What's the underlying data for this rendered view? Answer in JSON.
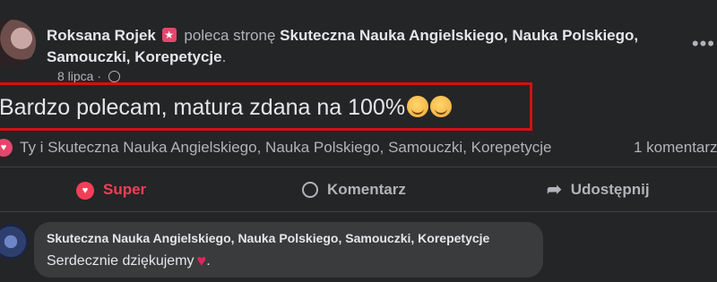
{
  "post": {
    "author": "Roksana Rojek",
    "verb": "poleca stronę",
    "page_name": "Skuteczna Nauka Angielskiego, Nauka Polskiego, Samouczki, Korepetycje",
    "page_suffix": ".",
    "date": "8 lipca",
    "separator": "·",
    "text": "Bardzo polecam, matura zdana na 100%"
  },
  "reactions": {
    "text": "Ty i Skuteczna Nauka Angielskiego, Nauka Polskiego, Samouczki, Korepetycje",
    "comments_count": "1 komentarz"
  },
  "actions": {
    "super_label": "Super",
    "comment_label": "Komentarz",
    "share_label": "Udostępnij"
  },
  "comment": {
    "author": "Skuteczna Nauka Angielskiego, Nauka Polskiego, Samouczki, Korepetycje",
    "text": "Serdecznie dziękujemy"
  },
  "colors": {
    "background": "#242526",
    "highlight_border": "#d51010",
    "super_accent": "#f33e58"
  }
}
